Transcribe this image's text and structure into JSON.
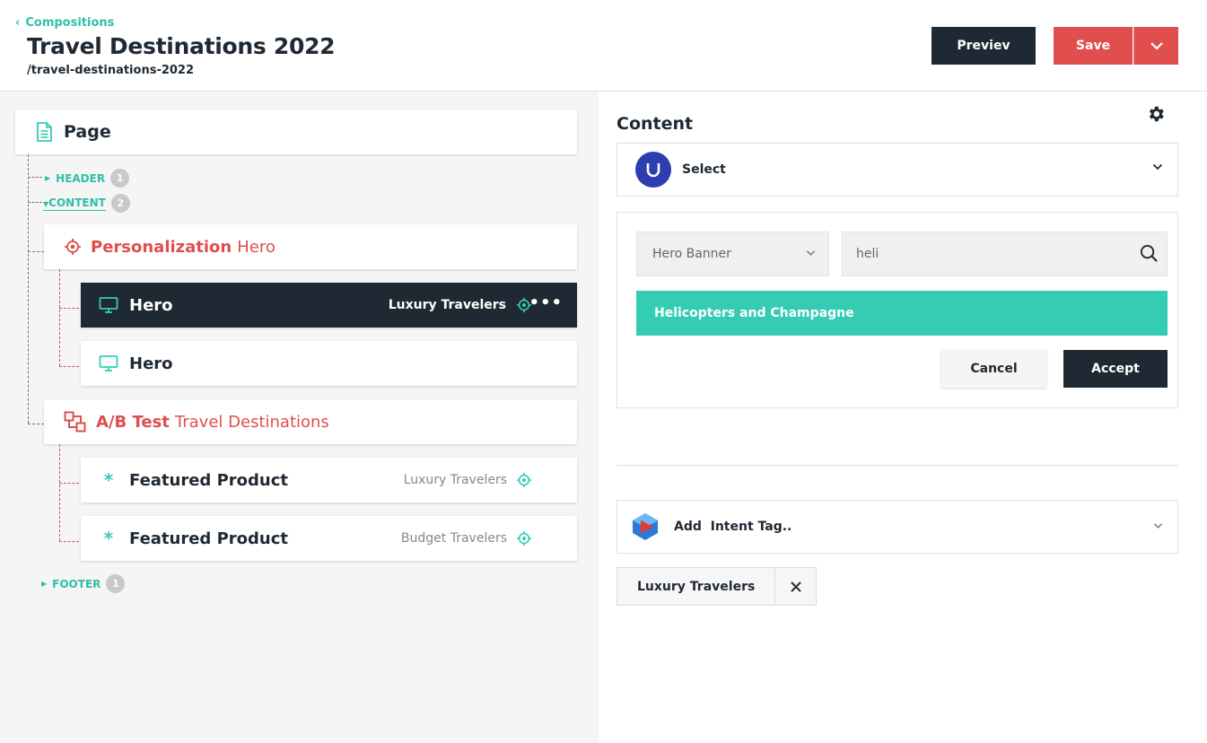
{
  "header": {
    "back_label": "Compositions",
    "title": "Travel Destinations 2022",
    "slug": "/travel-destinations-2022",
    "preview_label": "Previev",
    "save_label": "Save"
  },
  "tree": {
    "page_label": "Page",
    "slots": {
      "header": {
        "name": "HEADER",
        "count": "1"
      },
      "content": {
        "name": "CONTENT",
        "count": "2"
      },
      "footer": {
        "name": "FOOTER",
        "count": "1"
      }
    },
    "groups": [
      {
        "kind": "Personalization",
        "name": "Hero",
        "items": [
          {
            "name": "Hero",
            "audience": "Luxury Travelers"
          },
          {
            "name": "Hero",
            "audience": ""
          }
        ]
      },
      {
        "kind": "A/B Test",
        "name": "Travel Destinations",
        "items": [
          {
            "name": "Featured Product",
            "audience": "Luxury Travelers"
          },
          {
            "name": "Featured Product",
            "audience": "Budget Travelers"
          }
        ]
      }
    ]
  },
  "editor": {
    "section_title": "Content",
    "source_select_label": "Select",
    "picker": {
      "type_value": "Hero Banner",
      "search_value": "heli",
      "result": "Helicopters and Champagne",
      "cancel_label": "Cancel",
      "accept_label": "Accept"
    },
    "intent": {
      "add_label": "Add  Intent Tag..",
      "tags": [
        "Luxury Travelers"
      ]
    }
  },
  "colors": {
    "dark": "#1f2933",
    "accent_teal": "#34cdb3",
    "accent_red": "#e04e4e",
    "panel_bg": "#f5f5f5"
  },
  "icons": {
    "page": "document-icon",
    "personalization": "target-icon",
    "ab_test": "ab-test-icon",
    "hero_component": "monitor-icon",
    "featured_component": "asterisk-icon",
    "settings": "gear-icon",
    "search": "search-icon",
    "remove_tag": "close-icon"
  }
}
